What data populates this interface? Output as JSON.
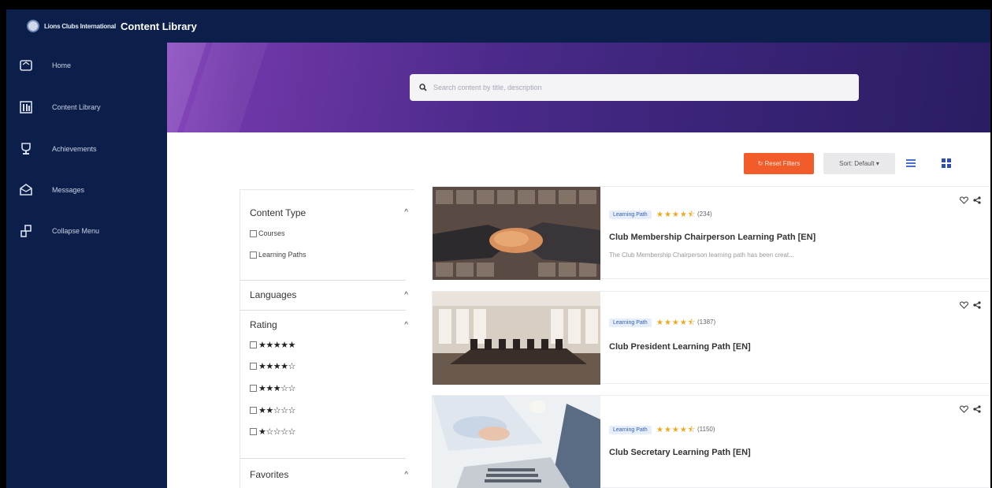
{
  "header": {
    "brand": "Lions Clubs International",
    "title": "Content Library"
  },
  "sidebar": {
    "items": [
      {
        "label": "Home",
        "icon": "home-icon"
      },
      {
        "label": "Content Library",
        "icon": "library-icon"
      },
      {
        "label": "Achievements",
        "icon": "trophy-icon"
      },
      {
        "label": "Messages",
        "icon": "messages-icon"
      },
      {
        "label": "Collapse Menu",
        "icon": "collapse-icon"
      }
    ]
  },
  "search": {
    "placeholder": "Search content by title, description"
  },
  "toolbar": {
    "reset_label": "↻ Reset Filters",
    "sort_label": "Sort: Default ▾"
  },
  "filters": {
    "content_type": {
      "title": "Content Type",
      "options": [
        "Courses",
        "Learning Paths"
      ]
    },
    "languages": {
      "title": "Languages"
    },
    "rating": {
      "title": "Rating",
      "options": [
        "★★★★★",
        "★★★★☆",
        "★★★☆☆",
        "★★☆☆☆",
        "★☆☆☆☆"
      ]
    },
    "favorites": {
      "title": "Favorites"
    }
  },
  "cards": [
    {
      "badge": "Learning Path",
      "stars": "★★★★⯪",
      "count": "(234)",
      "title": "Club Membership Chairperson Learning Path [EN]",
      "description": "The Club Membership Chairperson learning path has been creat..."
    },
    {
      "badge": "Learning Path",
      "stars": "★★★★⯪",
      "count": "(1387)",
      "title": "Club President Learning Path [EN]",
      "description": ""
    },
    {
      "badge": "Learning Path",
      "stars": "★★★★⯪",
      "count": "(1150)",
      "title": "Club Secretary Learning Path [EN]",
      "description": ""
    }
  ],
  "colors": {
    "navy": "#0b1f4a",
    "accent_orange": "#f25c2a",
    "star": "#f2a81d",
    "badge_blue": "#2f5fb5"
  }
}
